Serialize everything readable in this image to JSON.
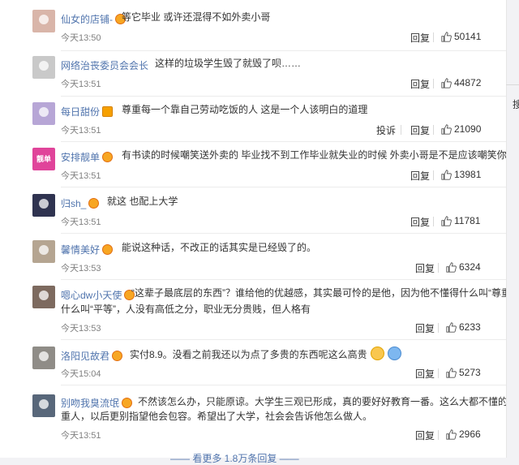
{
  "sidebar": {
    "partial_char": "搜"
  },
  "comments": [
    {
      "user": "仙女的店铺-",
      "badge": "emoji",
      "text": "等它毕业 或许还混得不如外卖小哥",
      "time": "今天13:50",
      "reply": "回复",
      "likes": "50141",
      "avatar": {
        "color": "#d9b5a9",
        "label": ""
      }
    },
    {
      "user": "网络治丧委员会会长",
      "badge": "none",
      "text": "这样的垃圾学生毁了就毁了呗……",
      "time": "今天13:51",
      "reply": "回复",
      "likes": "44872",
      "avatar": {
        "color": "#c9c9c9",
        "label": ""
      }
    },
    {
      "user": "每日甜份",
      "badge": "vip",
      "text": "尊重每一个靠自己劳动吃饭的人 这是一个人该明白的道理",
      "time": "今天13:51",
      "report": "投诉",
      "reply": "回复",
      "likes": "21090",
      "avatar": {
        "color": "#b7a6d6",
        "label": ""
      }
    },
    {
      "user": "安排靓单",
      "badge": "emoji",
      "text": "有书读的时候嘲笑送外卖的 毕业找不到工作毕业就失业的时候 外卖小哥是不是应该嘲笑你",
      "time": "今天13:51",
      "reply": "回复",
      "likes": "13981",
      "avatar": {
        "color": "#e0449a",
        "label": "靓单"
      }
    },
    {
      "user": "归sh_",
      "badge": "emoji",
      "text": "就这 也配上大学",
      "time": "今天13:51",
      "reply": "回复",
      "likes": "11781",
      "avatar": {
        "color": "#2f3350",
        "label": ""
      }
    },
    {
      "user": "馨情美好",
      "badge": "emoji",
      "text": "能说这种话，不改正的话其实是已经毁了的。",
      "time": "今天13:53",
      "reply": "回复",
      "likes": "6324",
      "avatar": {
        "color": "#b5a591",
        "label": ""
      }
    },
    {
      "user": "嗯心dw小天使",
      "badge": "emoji",
      "text_lines": [
        "“这辈子最底层的东西”？谁给他的优越感，其实最可怜的是他，因为他不懂得什么叫“尊重”",
        "什么叫“平等”，人没有高低之分，职业无分贵贱，但人格有"
      ],
      "time": "今天13:53",
      "reply": "回复",
      "likes": "6233",
      "avatar": {
        "color": "#7d6a5f",
        "label": ""
      }
    },
    {
      "user": "洛阳见故君",
      "badge": "emoji",
      "text": "实付8.9。没看之前我还以为点了多贵的东西呢这么高贵",
      "time": "今天15:04",
      "reply": "回复",
      "likes": "5273",
      "avatar": {
        "color": "#8f8c87",
        "label": ""
      }
    },
    {
      "user": "别吻我臭流氓",
      "badge": "emoji",
      "text_lines": [
        "不然该怎么办，只能原谅。大学生三观已形成，真的要好好教育一番。这么大都不懂的尊",
        "重人，以后更别指望他会包容。希望出了大学，社会会告诉他怎么做人。"
      ],
      "time": "今天13:51",
      "reply": "回复",
      "likes": "2966",
      "avatar": {
        "color": "#58677a",
        "label": ""
      }
    }
  ],
  "footer": {
    "partial_link": "—— 看更多 1.8万条回复 ——"
  }
}
